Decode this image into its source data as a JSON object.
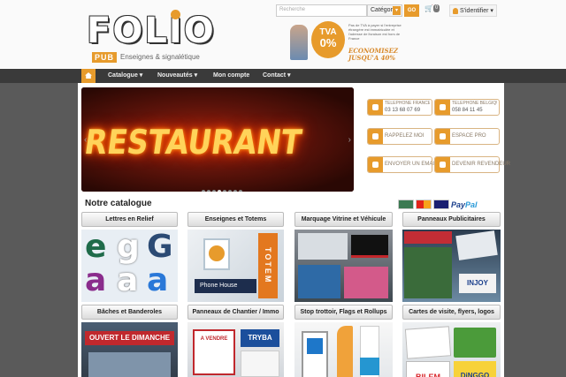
{
  "brand": {
    "logo_text": "FOLIO",
    "logo_sub": "PUB",
    "tagline": "Enseignes & signalétique"
  },
  "header": {
    "search_placeholder": "Recherche",
    "category_label": "Catégorie",
    "go_label": "GO",
    "cart_count": "0",
    "signin_label": "S'identifier"
  },
  "promo": {
    "tva_label": "TVA",
    "tva_value": "0%",
    "fine_print": "Pas de TVA à payer si l'entreprise étrangère est immatriculée et l'adresse de livraison est hors de France",
    "economy_line1": "ECONOMISEZ",
    "economy_line2": "JUSQU'A 40%"
  },
  "nav": {
    "items": [
      {
        "label": "Catalogue"
      },
      {
        "label": "Nouveautés"
      },
      {
        "label": "Mon compte"
      },
      {
        "label": "Contact"
      }
    ]
  },
  "slider": {
    "neon_text": "RESTAURANT",
    "dot_count": 8,
    "active_dot": 3
  },
  "cta": {
    "tel_fr_label": "TELEPHONE FRANCE",
    "tel_fr_number": "03 13 68 07 69",
    "tel_be_label": "TELEPHONE BELGIQUE",
    "tel_be_number": "058 84 11 45",
    "callback_label": "RAPPELEZ MOI",
    "pro_label": "ESPACE PRO",
    "email_label": "ENVOYER UN EMAIL",
    "reseller_label": "DEVENIR REVENDEUR"
  },
  "catalog": {
    "title": "Notre catalogue",
    "paypal_left": "Pay",
    "paypal_right": "Pal",
    "categories": [
      {
        "label": "Lettres en Relief"
      },
      {
        "label": "Enseignes et Totems"
      },
      {
        "label": "Marquage Vitrine et Véhicule"
      },
      {
        "label": "Panneaux Publicitaires"
      },
      {
        "label": "Bâches et Banderoles"
      },
      {
        "label": "Panneaux de Chantier / Immo"
      },
      {
        "label": "Stop trottoir, Flags et Rollups"
      },
      {
        "label": "Cartes de visite, flyers, logos"
      }
    ],
    "img_text": {
      "totem": "TOTEM",
      "phone": "Phone House",
      "bache": "OUVERT LE DIMANCHE",
      "chantier": "A VENDRE",
      "tryba": "TRYBA",
      "bilem": "BILEM",
      "dinggo": "DiNGGO",
      "injoy": "INJOY"
    }
  },
  "colors": {
    "accent": "#e79b2c",
    "nav_bg": "#3a3a3a",
    "page_bg": "#5a5a5a"
  }
}
